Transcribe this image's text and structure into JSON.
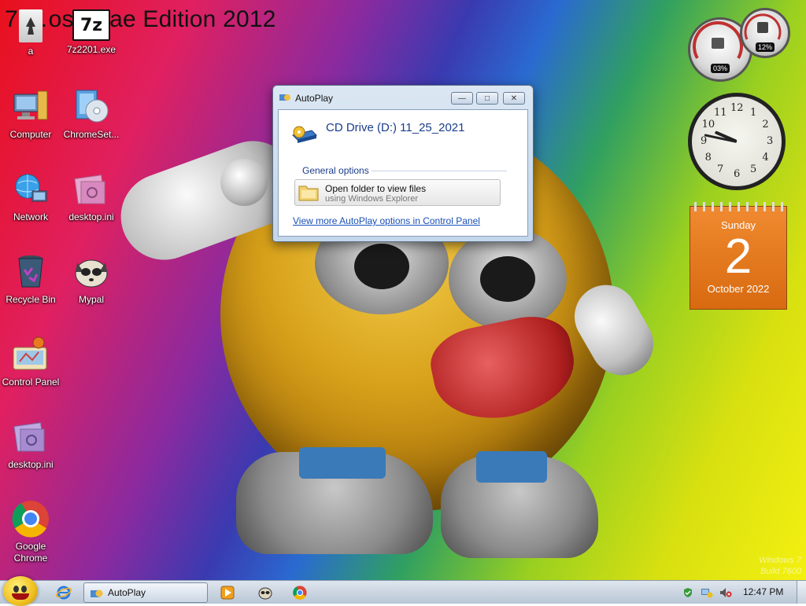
{
  "desktop": {
    "title": "7 …oss…ae Edition 2012",
    "watermark_line1": "Windows 7",
    "watermark_line2": "Build 7600",
    "icons": [
      {
        "label": "a",
        "icon": "document-icon"
      },
      {
        "label": "7z2201.exe",
        "icon": "7zip-icon"
      },
      {
        "label": "Computer",
        "icon": "computer-icon"
      },
      {
        "label": "ChromeSet...",
        "icon": "installer-icon"
      },
      {
        "label": "Network",
        "icon": "network-icon"
      },
      {
        "label": "desktop.ini",
        "icon": "settings-file-icon"
      },
      {
        "label": "Recycle Bin",
        "icon": "recycle-bin-icon"
      },
      {
        "label": "Mypal",
        "icon": "mypal-browser-icon"
      },
      {
        "label": "Control Panel",
        "icon": "control-panel-icon"
      },
      {
        "label": "desktop.ini",
        "icon": "settings-file-icon"
      },
      {
        "label": "Google Chrome",
        "icon": "chrome-icon"
      }
    ]
  },
  "gadgets": {
    "cpu_meter": {
      "cpu": "03%",
      "ram": "12%",
      "cpu_level": 0.03,
      "ram_level": 0.12
    },
    "clock": {
      "hour": 9,
      "minute": 47,
      "numbers": [
        "12",
        "1",
        "2",
        "3",
        "4",
        "5",
        "6",
        "7",
        "8",
        "9",
        "10",
        "11"
      ]
    },
    "calendar": {
      "day_name": "Sunday",
      "day_number": "2",
      "month_year": "October 2022"
    }
  },
  "dialog": {
    "title": "AutoPlay",
    "drive_title": "CD Drive (D:) 11_25_2021",
    "section_heading": "General options",
    "option_title": "Open folder to view files",
    "option_subtitle": "using Windows Explorer",
    "more_link": "View more AutoPlay options in Control Panel",
    "minimize_glyph": "—",
    "maximize_glyph": "□",
    "close_glyph": "✕"
  },
  "taskbar": {
    "task_label": "AutoPlay",
    "time": "12:47 PM",
    "pinned": [
      "internet-explorer-icon",
      "media-player-icon",
      "mypal-icon",
      "chrome-icon"
    ]
  },
  "colors": {
    "link": "#1a4fb8",
    "dialog_heading": "#1a3c8a",
    "calendar": "#e87820"
  }
}
